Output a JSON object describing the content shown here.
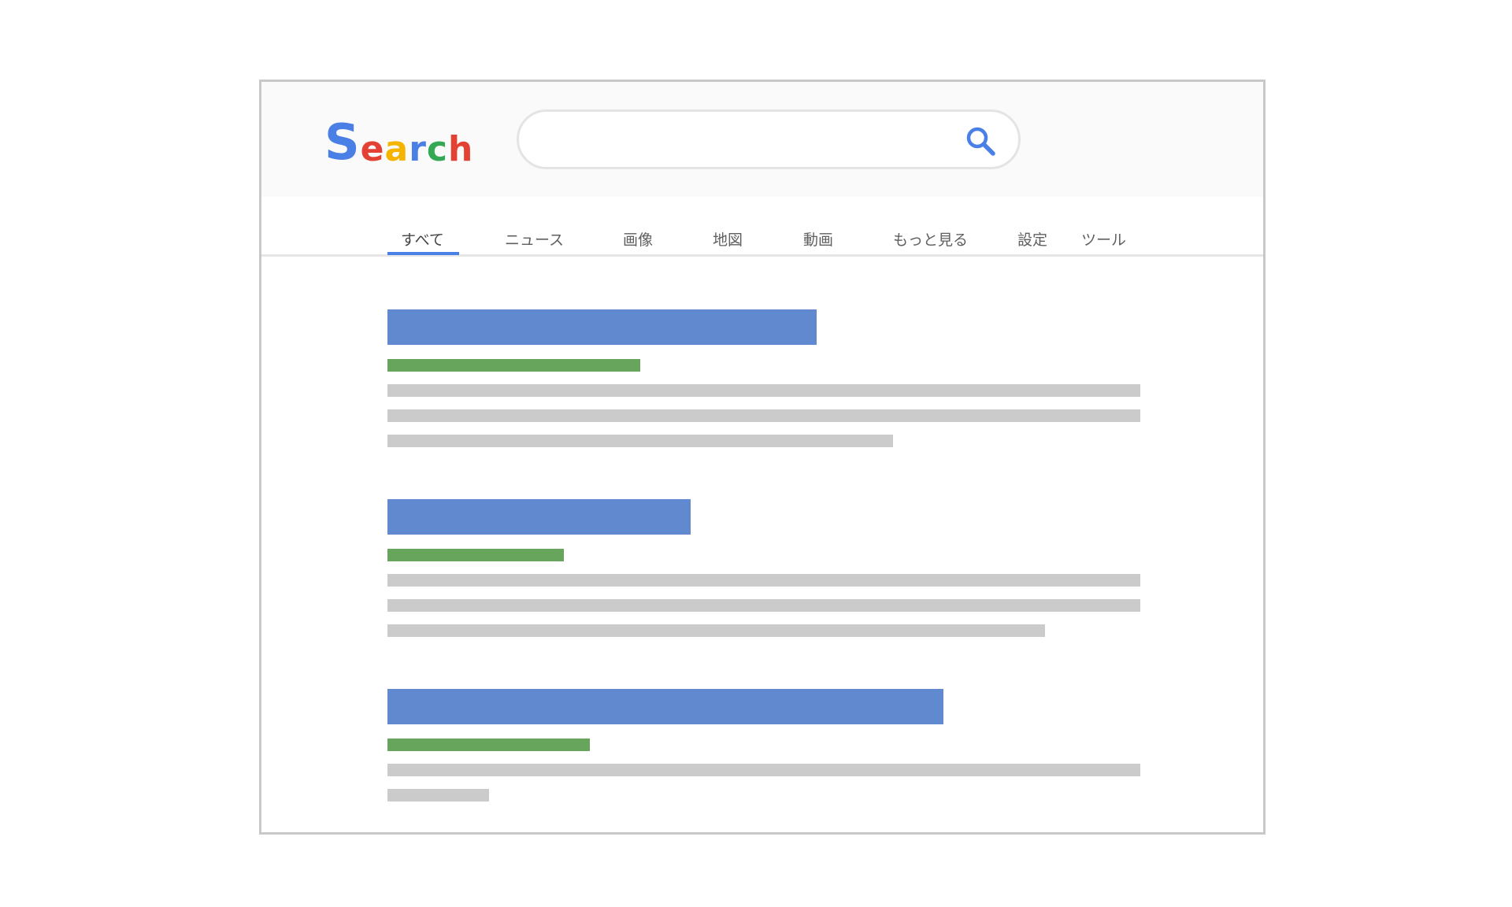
{
  "logo": {
    "letters": [
      {
        "char": "S",
        "color": "#4a7fe6"
      },
      {
        "char": "e",
        "color": "#e34133"
      },
      {
        "char": "a",
        "color": "#f4b400"
      },
      {
        "char": "r",
        "color": "#4a7fe6"
      },
      {
        "char": "c",
        "color": "#34a853"
      },
      {
        "char": "h",
        "color": "#e34133"
      }
    ]
  },
  "search": {
    "value": "",
    "placeholder": "",
    "icon": "magnifier",
    "icon_color": "#4a7fe6"
  },
  "tabs": [
    {
      "label": "すべて",
      "active": true
    },
    {
      "label": "ニュース",
      "active": false
    },
    {
      "label": "画像",
      "active": false
    },
    {
      "label": "地図",
      "active": false
    },
    {
      "label": "動画",
      "active": false
    },
    {
      "label": "もっと見る",
      "active": false
    },
    {
      "label": "設定",
      "active": false
    },
    {
      "label": "ツール",
      "active": false
    }
  ],
  "colors": {
    "accent": "#4a7fe6",
    "result_title": "#6089cf",
    "result_url": "#67a55c",
    "result_text": "#cbcbcb",
    "frame_border": "#c8c8c8"
  }
}
